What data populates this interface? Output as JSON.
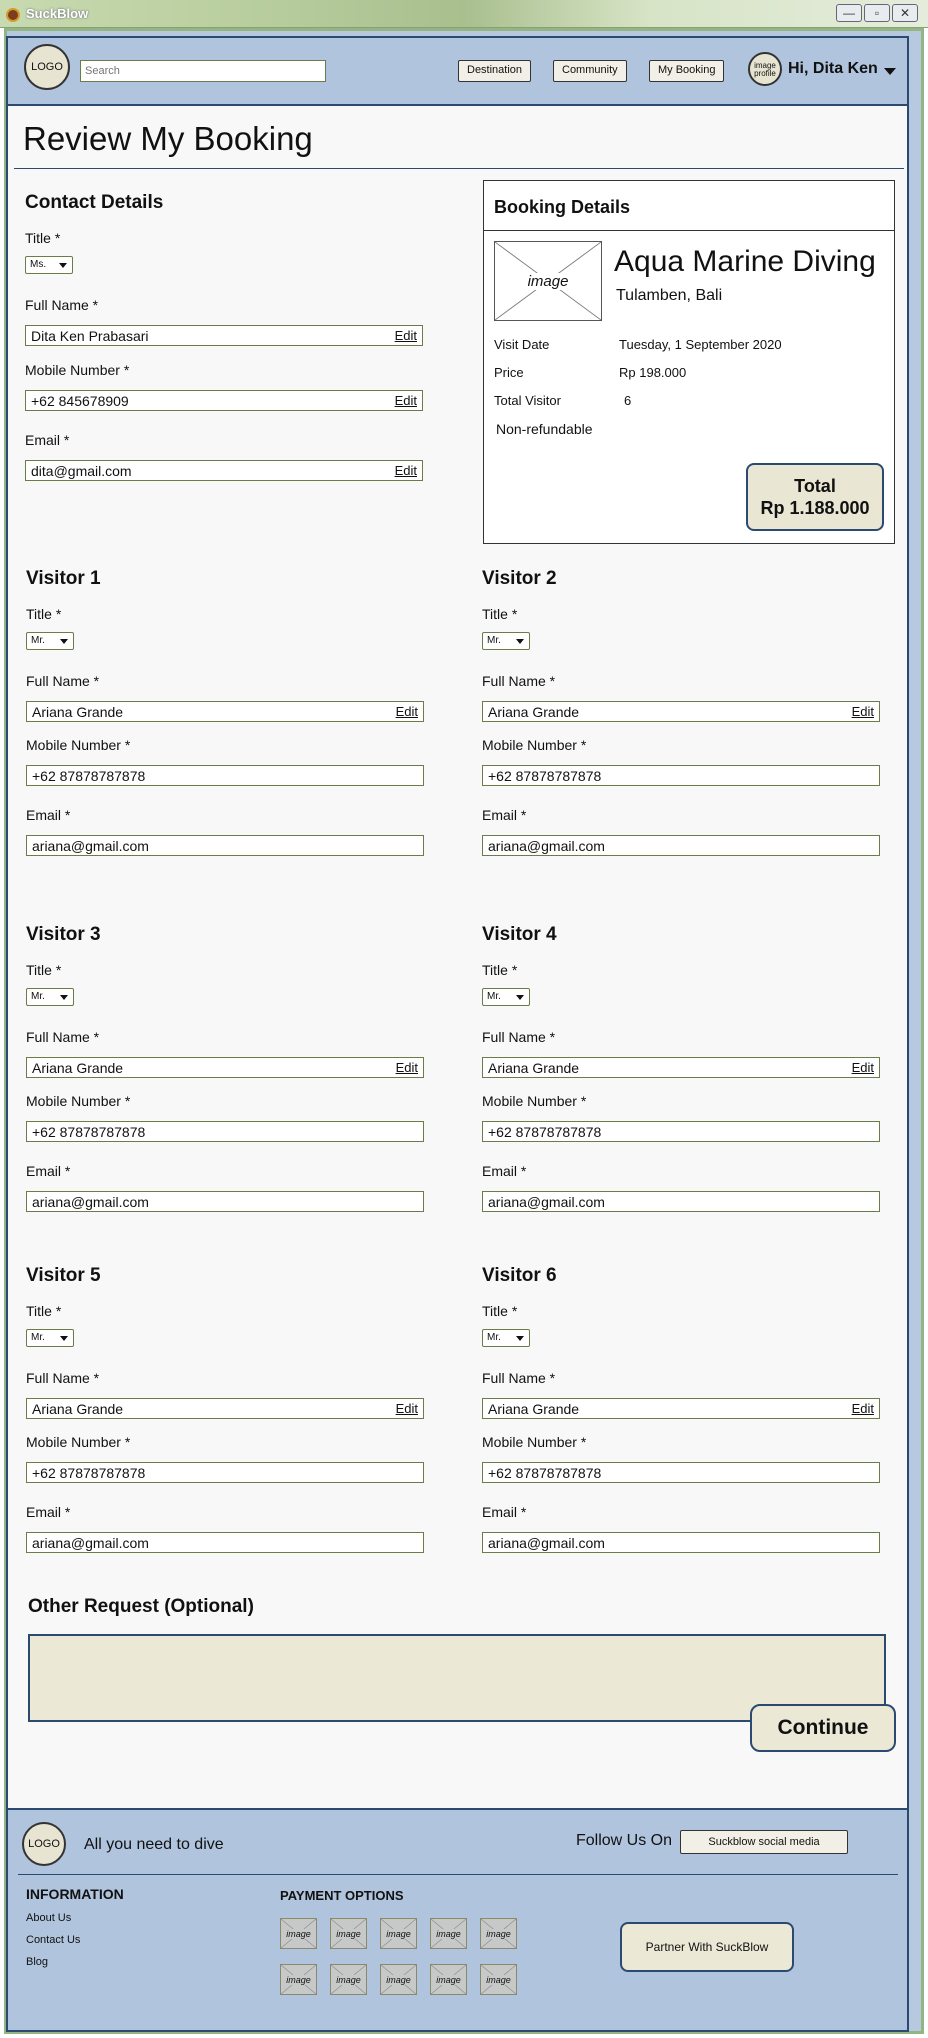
{
  "window": {
    "title": "SuckBlow",
    "min_glyph": "—",
    "max_glyph": "▫",
    "close_glyph": "✕"
  },
  "header": {
    "logo": "LOGO",
    "search_placeholder": "Search",
    "nav": [
      "Destination",
      "Community",
      "My Booking"
    ],
    "avatar_text": "image profile",
    "greeting": "Hi, Dita Ken"
  },
  "page_title": "Review My Booking",
  "contact": {
    "heading": "Contact Details",
    "title_label": "Title *",
    "title_value": "Ms.",
    "name_label": "Full Name *",
    "name_value": "Dita Ken Prabasari",
    "mobile_label": "Mobile Number *",
    "mobile_value": "+62 845678909",
    "email_label": "Email *",
    "email_value": "dita@gmail.com",
    "edit": "Edit"
  },
  "booking": {
    "heading": "Booking Details",
    "image_text": "image",
    "destination": "Aqua Marine Diving",
    "location": "Tulamben, Bali",
    "visit_date_label": "Visit Date",
    "visit_date": "Tuesday, 1 September 2020",
    "price_label": "Price",
    "price": "Rp 198.000",
    "visitors_label": "Total Visitor",
    "visitors": "6",
    "refund": "Non-refundable",
    "total_label": "Total",
    "total_value": "Rp 1.188.000"
  },
  "visitors": [
    {
      "heading": "Visitor 1",
      "title_label": "Title *",
      "title_value": "Mr.",
      "name_label": "Full Name *",
      "name_value": "Ariana Grande",
      "mobile_label": "Mobile Number *",
      "mobile_value": "+62 87878787878",
      "email_label": "Email *",
      "email_value": "ariana@gmail.com",
      "edit": "Edit"
    },
    {
      "heading": "Visitor 2",
      "title_label": "Title *",
      "title_value": "Mr.",
      "name_label": "Full Name *",
      "name_value": "Ariana Grande",
      "mobile_label": "Mobile Number *",
      "mobile_value": "+62 87878787878",
      "email_label": "Email *",
      "email_value": "ariana@gmail.com",
      "edit": "Edit"
    },
    {
      "heading": "Visitor 3",
      "title_label": "Title *",
      "title_value": "Mr.",
      "name_label": "Full Name *",
      "name_value": "Ariana Grande",
      "mobile_label": "Mobile Number *",
      "mobile_value": "+62 87878787878",
      "email_label": "Email *",
      "email_value": "ariana@gmail.com",
      "edit": "Edit"
    },
    {
      "heading": "Visitor 4",
      "title_label": "Title *",
      "title_value": "Mr.",
      "name_label": "Full Name *",
      "name_value": "Ariana Grande",
      "mobile_label": "Mobile Number *",
      "mobile_value": "+62 87878787878",
      "email_label": "Email *",
      "email_value": "ariana@gmail.com",
      "edit": "Edit"
    },
    {
      "heading": "Visitor 5",
      "title_label": "Title *",
      "title_value": "Mr.",
      "name_label": "Full Name *",
      "name_value": "Ariana Grande",
      "mobile_label": "Mobile Number *",
      "mobile_value": "+62 87878787878",
      "email_label": "Email *",
      "email_value": "ariana@gmail.com",
      "edit": "Edit"
    },
    {
      "heading": "Visitor 6",
      "title_label": "Title *",
      "title_value": "Mr.",
      "name_label": "Full Name *",
      "name_value": "Ariana Grande",
      "mobile_label": "Mobile Number *",
      "mobile_value": "+62 87878787878",
      "email_label": "Email *",
      "email_value": "ariana@gmail.com",
      "edit": "Edit"
    }
  ],
  "other_request": {
    "heading": "Other Request (Optional)",
    "value": ""
  },
  "continue_label": "Continue",
  "footer": {
    "logo": "LOGO",
    "tagline": "All you need to dive",
    "follow_label": "Follow Us On",
    "social_button": "Suckblow social media",
    "info_heading": "INFORMATION",
    "info_links": [
      "About Us",
      "Contact Us",
      "Blog"
    ],
    "payment_heading": "PAYMENT OPTIONS",
    "payment_image_text": "image",
    "partner_button": "Partner With SuckBlow"
  }
}
